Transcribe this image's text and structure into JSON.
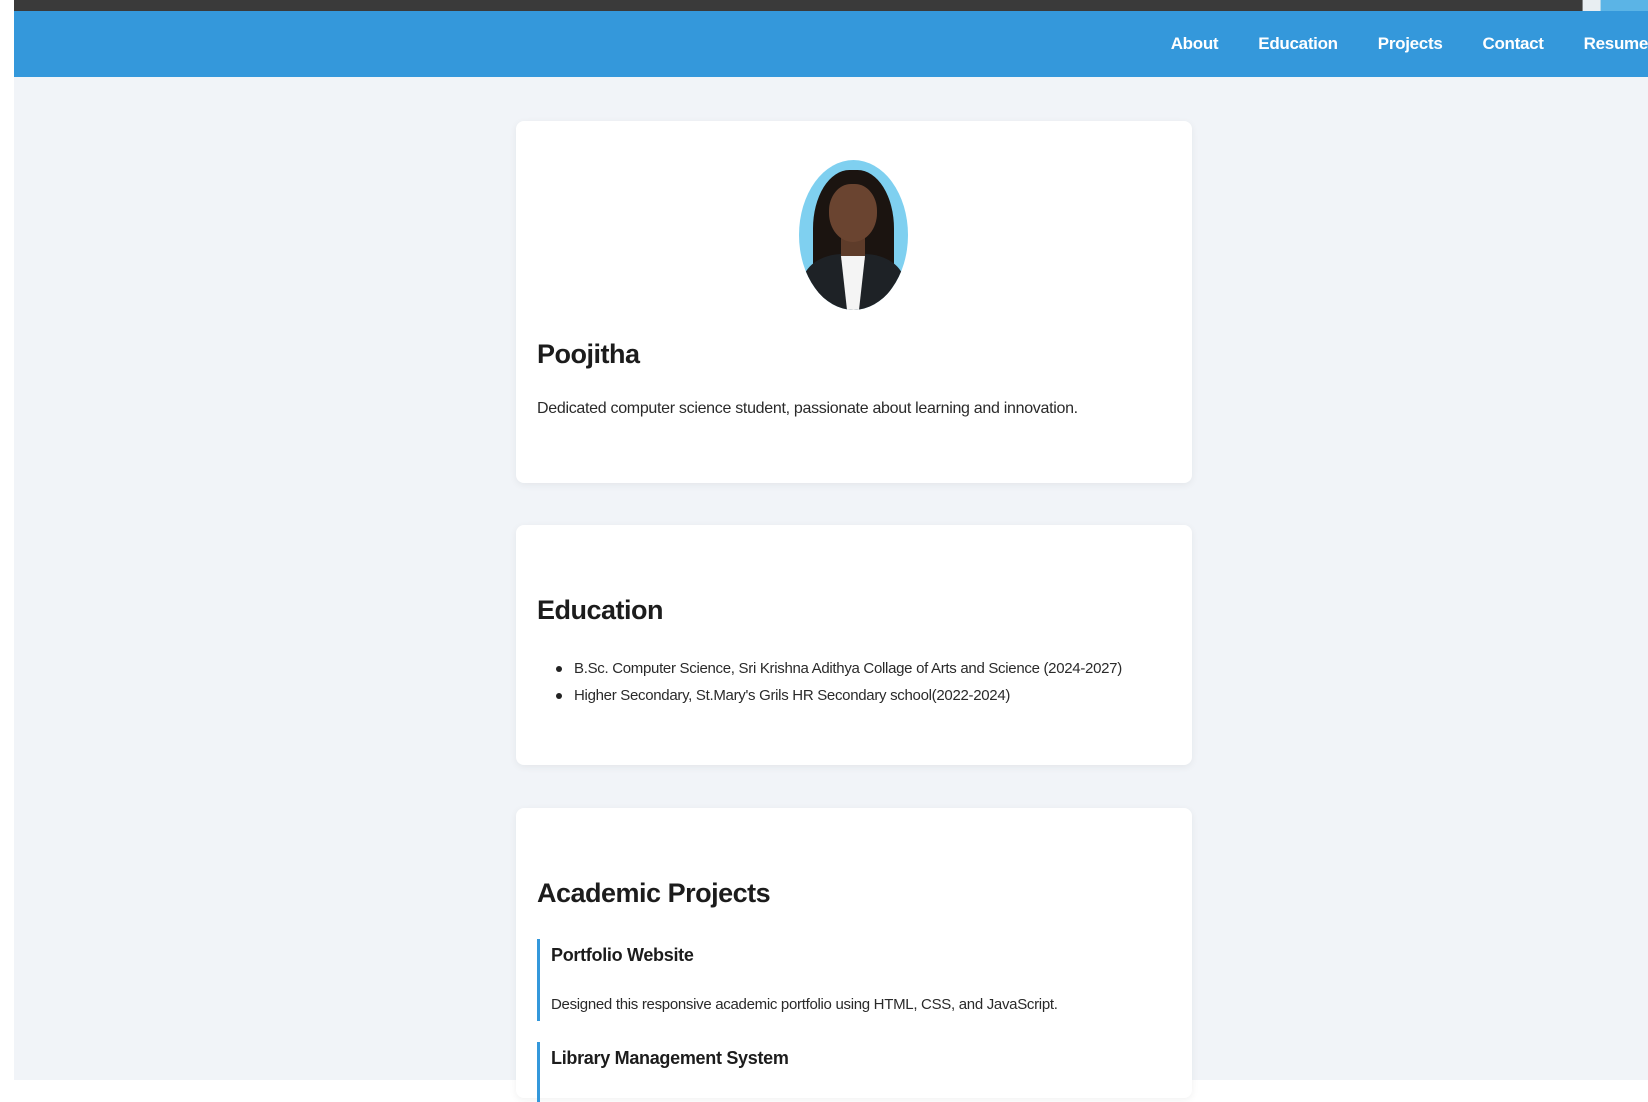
{
  "nav": {
    "links": [
      "About",
      "Education",
      "Projects",
      "Contact",
      "Resume"
    ]
  },
  "about": {
    "name": "Poojitha",
    "tagline": "Dedicated computer science student, passionate about learning and innovation."
  },
  "education": {
    "title": "Education",
    "items": [
      "B.Sc. Computer Science, Sri Krishna Adithya Collage of Arts and Science (2024-2027)",
      "Higher Secondary, St.Mary's Grils HR Secondary school(2022-2024)"
    ]
  },
  "projects": {
    "title": "Academic Projects",
    "items": [
      {
        "name": "Portfolio Website",
        "description": "Designed this responsive academic portfolio using HTML, CSS, and JavaScript."
      },
      {
        "name": "Library Management System",
        "description": ""
      }
    ]
  },
  "colors": {
    "navbar": "#3498db",
    "page_background": "#f1f4f8",
    "card": "#ffffff",
    "project_accent": "#3498db"
  },
  "icons": {
    "avatar": "profile-photo"
  }
}
